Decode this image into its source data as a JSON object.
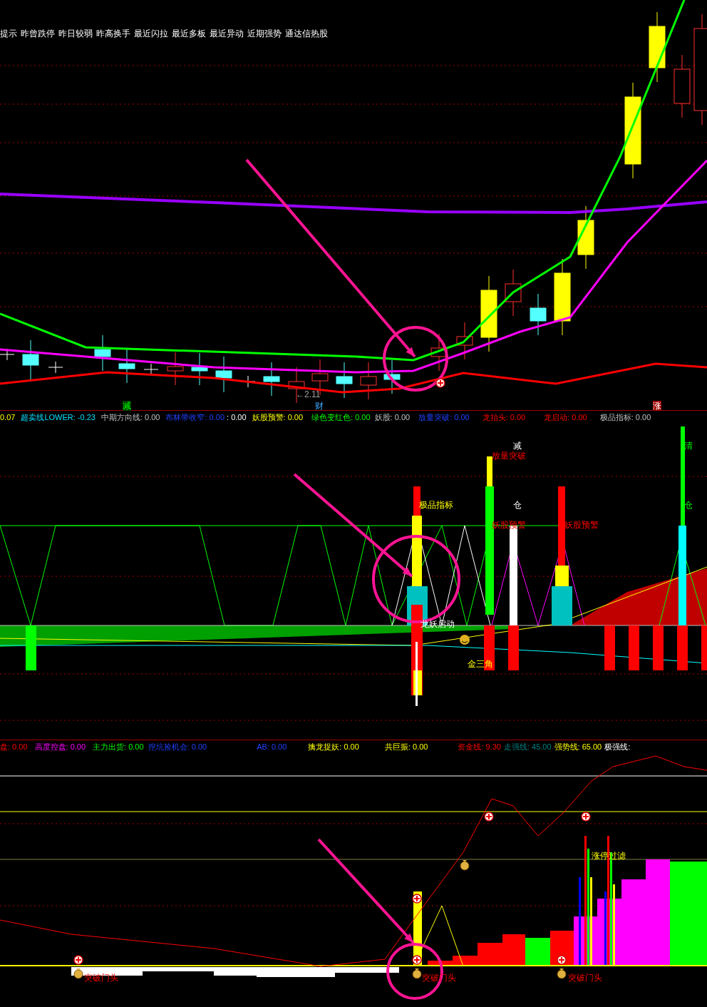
{
  "top_legend": [
    "提示",
    "昨曾跌停",
    "昨日较弱",
    "昨高换手",
    "最近闪拉",
    "最近多板",
    "最近异动",
    "近期强势",
    "通达信热股"
  ],
  "price_labels": [
    "←2.11",
    "减",
    "财",
    "涨"
  ],
  "indicator_legend": [
    "0.07",
    "超卖线LOWER: -0.23",
    "中期方向线: 0.00",
    "布林带收窄: 0.00",
    ": 0.00",
    "妖股预警: 0.00",
    "绿色变红色: 0.00",
    "妖股: 0.00",
    "放量突破: 0.00",
    "龙抬头: 0.00",
    "龙启动: 0.00",
    "极品指标: 0.00"
  ],
  "indicator_labels": [
    "减",
    "放量突破",
    "极品指标",
    "仓",
    "妖股预警",
    "妖股预警",
    "清",
    "仓",
    "龙妖启动",
    "金三角"
  ],
  "capital_legend": [
    "盘: 0.00",
    "高度控盘: 0.00",
    "主力出货: 0.00",
    "挖坑捡机会: 0.00",
    "AB: 0.00",
    "擒龙捉妖: 0.00",
    "共巨振: 0.00",
    "资金线: 9.30",
    "走强线: 45.00",
    "强势线: 65.00",
    "极强线:"
  ],
  "capital_labels": [
    "涨停过滤",
    "突破门头",
    "突破门头",
    "突破门头"
  ]
}
